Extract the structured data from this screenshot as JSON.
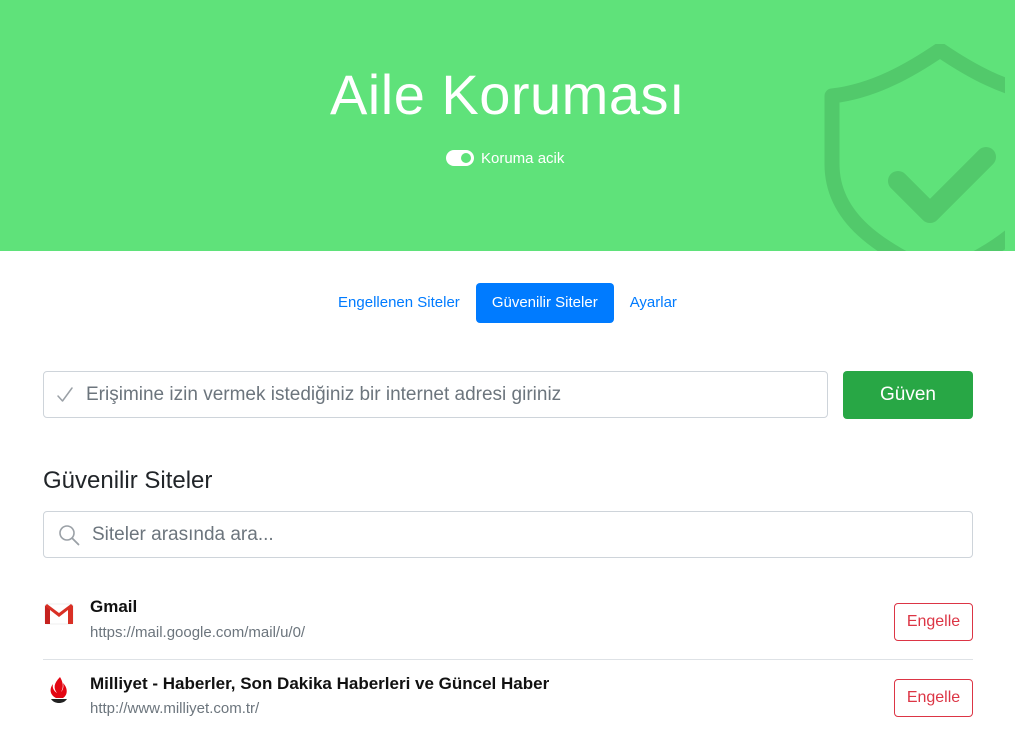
{
  "colors": {
    "hero_bg": "#5fe27a",
    "primary": "#007bff",
    "success": "#28a745",
    "danger": "#dc3545"
  },
  "hero": {
    "title": "Aile Koruması",
    "toggle_on": true,
    "toggle_label": "Koruma acik",
    "background_icon": "shield-check-icon"
  },
  "tabs": [
    {
      "label": "Engellenen Siteler",
      "active": false
    },
    {
      "label": "Güvenilir Siteler",
      "active": true
    },
    {
      "label": "Ayarlar",
      "active": false
    }
  ],
  "add_site": {
    "icon": "check-icon",
    "placeholder": "Erişimine izin vermek istediğiniz bir internet adresi giriniz",
    "value": "",
    "button_label": "Güven"
  },
  "section": {
    "title": "Güvenilir Siteler",
    "search_icon": "search-icon",
    "search_placeholder": "Siteler arasında ara...",
    "search_value": ""
  },
  "sites": [
    {
      "title": "Gmail",
      "url": "https://mail.google.com/mail/u/0/",
      "favicon": "gmail-icon",
      "action_label": "Engelle"
    },
    {
      "title": "Milliyet - Haberler, Son Dakika Haberleri ve Güncel Haber",
      "url": "http://www.milliyet.com.tr/",
      "favicon": "milliyet-icon",
      "action_label": "Engelle"
    }
  ]
}
